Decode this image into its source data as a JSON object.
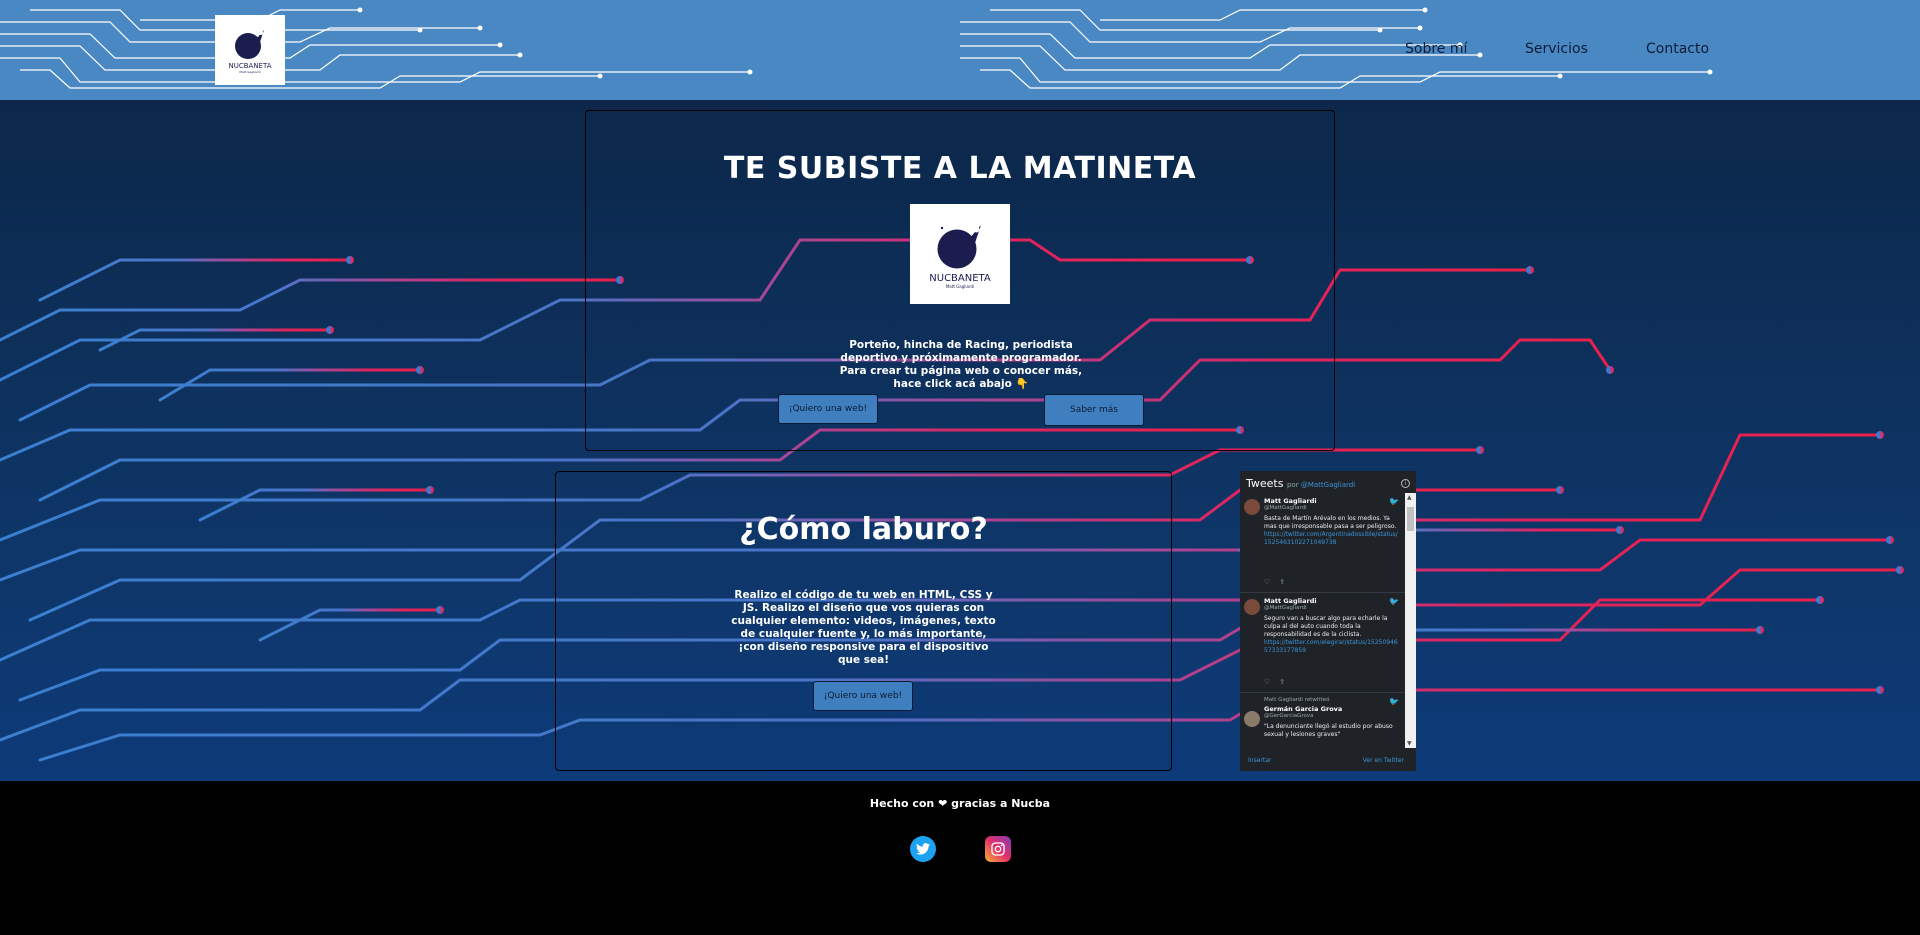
{
  "header": {
    "logo_text": "NUCBANETA",
    "logo_sub": "Matt Gagliardi",
    "nav": [
      {
        "label": "Sobre mí"
      },
      {
        "label": "Servicios"
      },
      {
        "label": "Contacto"
      }
    ]
  },
  "hero": {
    "title": "TE SUBISTE A LA MATINETA",
    "logo_text": "NUCBANETA",
    "logo_sub": "Matt Gagliardi",
    "text": "Porteño, hincha de Racing, periodista deportivo y próximamente programador. Para crear tu página web o conocer más, hace click acá abajo 👇",
    "button_web": "¡Quiero una web!",
    "button_more": "Saber más"
  },
  "work": {
    "title": "¿Cómo laburo?",
    "text": "Realizo el código de tu web en HTML, CSS y JS. Realizo el diseño que vos quieras con cualquier elemento: videos, imágenes, texto de cualquier fuente y, lo más importante, ¡con diseño responsive para el dispositivo que sea!",
    "button_web": "¡Quiero una web!"
  },
  "twitter": {
    "title": "Tweets",
    "by": "por",
    "by_handle": "@MattGagliardi",
    "tweets": [
      {
        "name": "Matt Gagliardi",
        "handle": "@MattGagliardi",
        "text": "Basta de Martín Arévalo en los medios. Ya mas que irresponsable pasa a ser peligroso.",
        "link": "https://twitter.com/Argentinadossible/status/1525463102271049738"
      },
      {
        "name": "Matt Gagliardi",
        "handle": "@MattGagliardi",
        "text": "Seguro van a buscar algo para echarle la culpa al del auto cuando toda la responsabilidad es de la ciclista.",
        "link": "https://twitter.com/elegirar/status/1525094657333177859"
      },
      {
        "retweet": "Matt Gagliardi retwitteó",
        "name": "Germán Garcia Grova",
        "handle": "@GerGarciaGrova",
        "text": "\"La denunciante llegó al estudio por abuso sexual y lesiones graves\""
      }
    ],
    "footer_left": "Insertar",
    "footer_right": "Ver en Twitter"
  },
  "footer": {
    "made_pre": "Hecho con",
    "heart": "❤",
    "made_post": "gracias a Nucba"
  },
  "colors": {
    "header_bg": "#4a88c4",
    "button_bg": "#3f7fc0",
    "circuit_blue": "#3b7fd0",
    "circuit_pink": "#e0245e"
  }
}
